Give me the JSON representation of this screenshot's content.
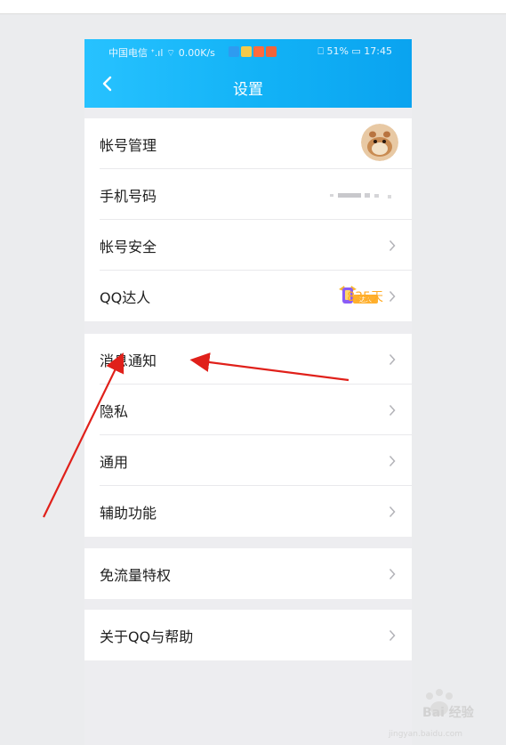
{
  "statusbar": {
    "carrier": "中国电信",
    "net_speed": "0.00K/s",
    "battery": "51%",
    "time": "17:45"
  },
  "header": {
    "title": "设置"
  },
  "groups": [
    {
      "items": [
        {
          "label": "帐号管理"
        },
        {
          "label": "手机号码"
        },
        {
          "label": "帐号安全"
        },
        {
          "label": "QQ达人",
          "badge_text": "达人",
          "days": "835天"
        }
      ]
    },
    {
      "items": [
        {
          "label": "消息通知"
        },
        {
          "label": "隐私"
        },
        {
          "label": "通用"
        },
        {
          "label": "辅助功能"
        }
      ]
    },
    {
      "items": [
        {
          "label": "免流量特权"
        }
      ]
    },
    {
      "items": [
        {
          "label": "关于QQ与帮助"
        }
      ]
    }
  ],
  "watermark": {
    "brand": "Bai 经验",
    "url": "jingyan.baidu.com"
  },
  "colors": {
    "header_start": "#27c2ff",
    "header_end": "#0aa3f0",
    "arrow": "#e0201a",
    "days": "#ffaa22"
  }
}
